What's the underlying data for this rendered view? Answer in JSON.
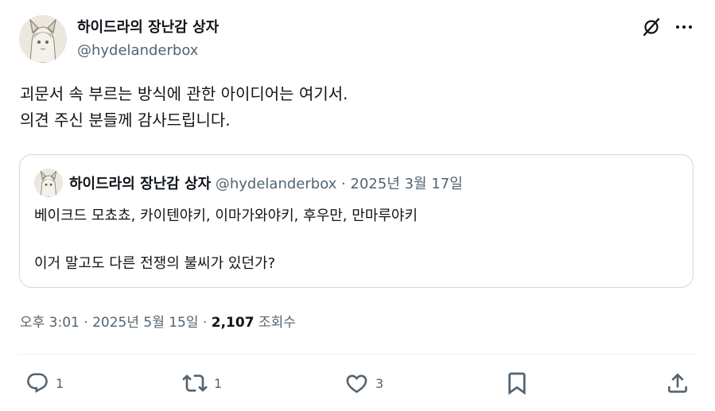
{
  "author": {
    "name": "하이드라의 장난감 상자",
    "handle": "@hydelanderbox"
  },
  "tweet": {
    "lines": [
      "괴문서 속 부르는 방식에 관한 아이디어는 여기서.",
      "의견 주신 분들께 감사드립니다."
    ]
  },
  "quote": {
    "name": "하이드라의 장난감 상자",
    "handle": "@hydelanderbox",
    "separator": "·",
    "date": "2025년 3월 17일",
    "lines": [
      "베이크드 모쵸쵸, 카이텐야키, 이마가와야키, 후우만, 만마루야키",
      "",
      "이거 말고도 다른 전쟁의 불씨가 있던가?"
    ]
  },
  "meta": {
    "time": "오후 3:01",
    "sep1": "·",
    "date": "2025년 5월 15일",
    "sep2": "·",
    "views_count": "2,107",
    "views_label": "조회수"
  },
  "actions": {
    "reply_count": "1",
    "retweet_count": "1",
    "like_count": "3"
  },
  "icons": {
    "grok": "grok-icon",
    "more": "more-horizontal-icon",
    "reply": "reply-icon",
    "retweet": "retweet-icon",
    "like": "heart-icon",
    "bookmark": "bookmark-icon",
    "share": "share-icon"
  },
  "colors": {
    "text": "#0f1419",
    "secondary": "#536471",
    "border": "#cfd9de"
  }
}
